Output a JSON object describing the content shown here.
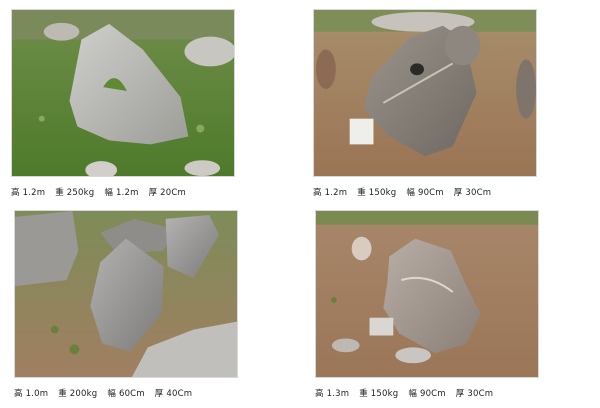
{
  "items": [
    {
      "height": "高 1.2m",
      "weight": "重 250kg",
      "width": "幅 1.2m",
      "thickness": "厚 20Cm"
    },
    {
      "height": "高 1.2m",
      "weight": "重 150kg",
      "width": "幅 90Cm",
      "thickness": "厚 30Cm"
    },
    {
      "height": "高 1.0m",
      "weight": "重 200kg",
      "width": "幅 60Cm",
      "thickness": "厚 40Cm"
    },
    {
      "height": "高 1.3m",
      "weight": "重 150kg",
      "width": "幅 90Cm",
      "thickness": "厚 30Cm"
    }
  ]
}
